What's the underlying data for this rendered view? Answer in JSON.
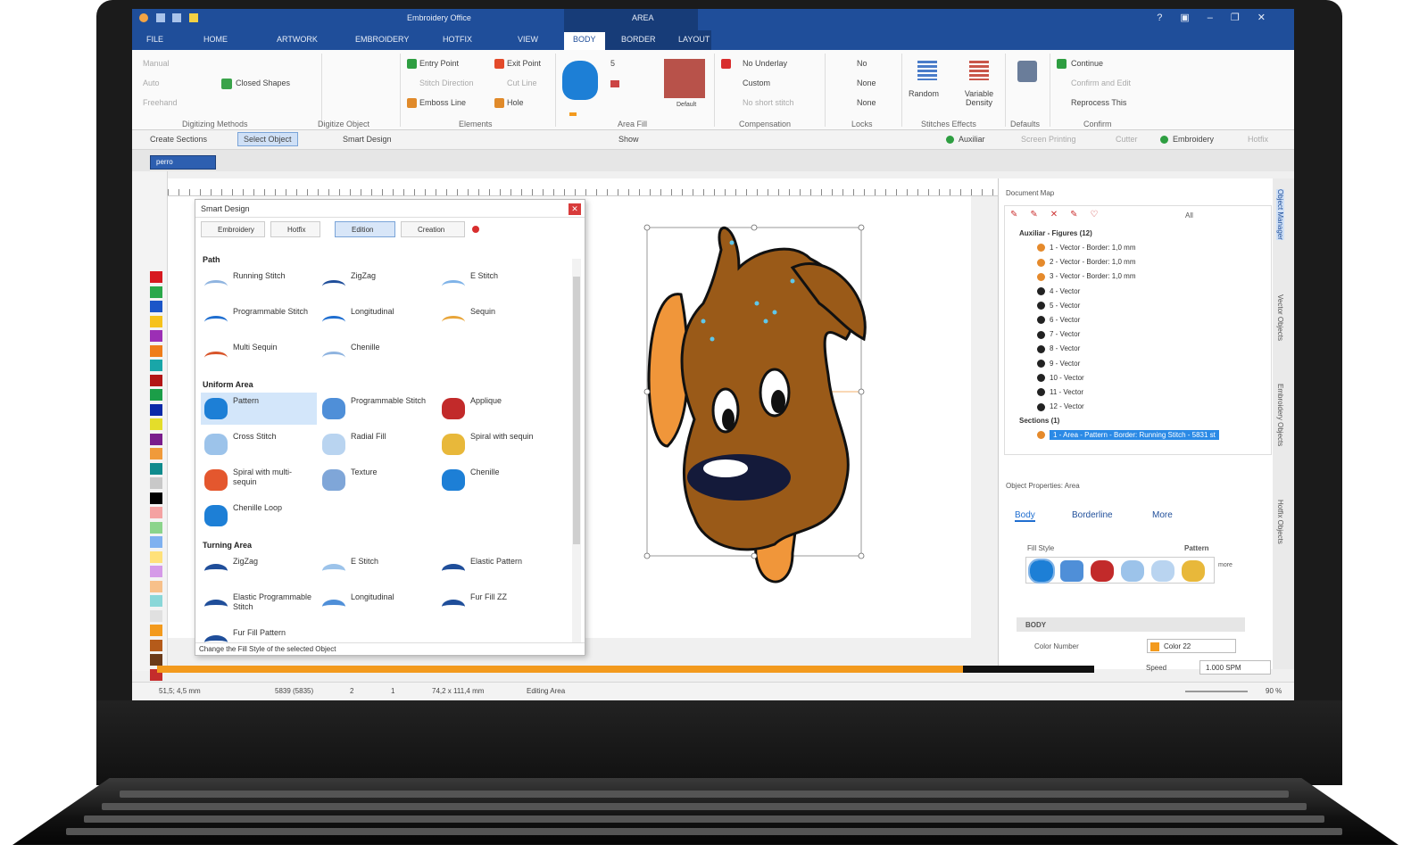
{
  "app": {
    "title": "Embroidery Office",
    "context_tab": "AREA",
    "window_buttons": [
      "?",
      "▣",
      "–",
      "❐",
      "✕"
    ]
  },
  "ribbon_tabs": [
    "FILE",
    "HOME",
    "ARTWORK",
    "EMBROIDERY",
    "HOTFIX",
    "VIEW",
    "BODY",
    "BORDER",
    "LAYOUT"
  ],
  "active_tab": "BODY",
  "ribbon": {
    "digitizing": {
      "items": [
        "Manual",
        "Auto",
        "Freehand"
      ],
      "closed_shapes": "Closed Shapes",
      "label": "Digitizing Methods"
    },
    "digitize_object": {
      "label": "Digitize Object"
    },
    "elements": {
      "items": [
        "Entry Point",
        "Exit Point",
        "Stitch Direction",
        "Cut Line",
        "Emboss Line",
        "Hole"
      ],
      "label": "Elements"
    },
    "area_fill": {
      "number": "5",
      "color_label": "Default",
      "label": "Area Fill"
    },
    "compensation": {
      "items": [
        "No Underlay",
        "Custom",
        "No short stitch"
      ],
      "label": "Compensation"
    },
    "locks": {
      "items": [
        "No",
        "None",
        "None"
      ],
      "label": "Locks"
    },
    "stitch_effects": {
      "items": [
        "Random",
        "Variable Density"
      ],
      "label": "Stitches Effects"
    },
    "defaults": {
      "label": "Defaults"
    },
    "confirm": {
      "items": [
        "Continue",
        "Confirm and Edit",
        "Reprocess This"
      ],
      "label": "Confirm"
    }
  },
  "toolbar2": {
    "create_sections": "Create Sections",
    "select_object": "Select Object",
    "smart_design": "Smart Design",
    "show": "Show",
    "right": [
      "Auxiliar",
      "Screen Printing",
      "Cutter",
      "Embroidery",
      "Hotfix"
    ]
  },
  "doc_tab": "perro",
  "smart_design": {
    "title": "Smart Design",
    "close": "✕",
    "tabs": [
      "Embroidery",
      "Hotfix"
    ],
    "modes": [
      "Edition",
      "Creation"
    ],
    "sections": [
      {
        "title": "Path",
        "items": [
          "Running Stitch",
          "ZigZag",
          "E Stitch",
          "Programmable Stitch",
          "Longitudinal",
          "Sequin",
          "Multi Sequin",
          "Chenille"
        ]
      },
      {
        "title": "Uniform Area",
        "items": [
          "Pattern",
          "Programmable Stitch",
          "Applique",
          "Cross Stitch",
          "Radial Fill",
          "Spiral with sequin",
          "Spiral with multi-sequin",
          "Texture",
          "Chenille",
          "Chenille Loop"
        ]
      },
      {
        "title": "Turning Area",
        "items": [
          "ZigZag",
          "E Stitch",
          "Elastic Pattern",
          "Elastic Programmable Stitch",
          "Longitudinal",
          "Fur Fill ZZ",
          "Fur Fill Pattern"
        ]
      }
    ],
    "status": "Change the Fill Style of the selected Object"
  },
  "document_map": {
    "title": "Document Map",
    "all": "All",
    "group1": "Auxiliar - Figures (12)",
    "items": [
      "1 - Vector - Border: 1,0 mm",
      "2 - Vector - Border: 1,0 mm",
      "3 - Vector - Border: 1,0 mm",
      "4 - Vector",
      "5 - Vector",
      "6 - Vector",
      "7 - Vector",
      "8 - Vector",
      "9 - Vector",
      "10 - Vector",
      "11 - Vector",
      "12 - Vector"
    ],
    "group2": "Sections (1)",
    "selected": "1 - Area - Pattern - Border: Running Stitch - 5831 st"
  },
  "object_properties": {
    "title": "Object Properties: Area",
    "tabs": [
      "Body",
      "Borderline",
      "More"
    ],
    "fill_style": "Fill Style",
    "pattern": "Pattern",
    "more": "more",
    "body_header": "BODY",
    "color_number": "Color Number",
    "color_value": "Color 22"
  },
  "side_tabs": [
    "Object Manager",
    "Vector Objects",
    "Embroidery Objects",
    "Hotfix Objects"
  ],
  "playback": {
    "progress": 0.86,
    "speed_label": "Speed",
    "speed_value": "1.000 SPM"
  },
  "status_bar": {
    "coords": "51,5; 4,5 mm",
    "stitches": "5839 (5835)",
    "count1": "2",
    "count2": "1",
    "size": "74,2 x 111,4 mm",
    "mode": "Editing Area",
    "zoom": "90 %"
  },
  "palette": [
    "#d71920",
    "#2aa84a",
    "#1c56c8",
    "#f6c21b",
    "#9c2fb5",
    "#ef7d1a",
    "#19a6a8",
    "#b31515",
    "#1b9e48",
    "#0b2aa8",
    "#e4dd2a",
    "#7a1d8c",
    "#f09a3a",
    "#0f8b8d",
    "#c8c8c8",
    "#000000",
    "#f4a2a2",
    "#8bd48b",
    "#7fb1f0",
    "#ffe17a",
    "#d59ae8",
    "#f7c08a",
    "#8ad7d8",
    "#e0e0e0",
    "#f39a1d",
    "#b55b1a",
    "#6b3b1a",
    "#c42c2c"
  ],
  "colors": {
    "accent": "#1f4e9a",
    "dog_brown": "#9a5a18",
    "dog_orange": "#f0963a"
  }
}
